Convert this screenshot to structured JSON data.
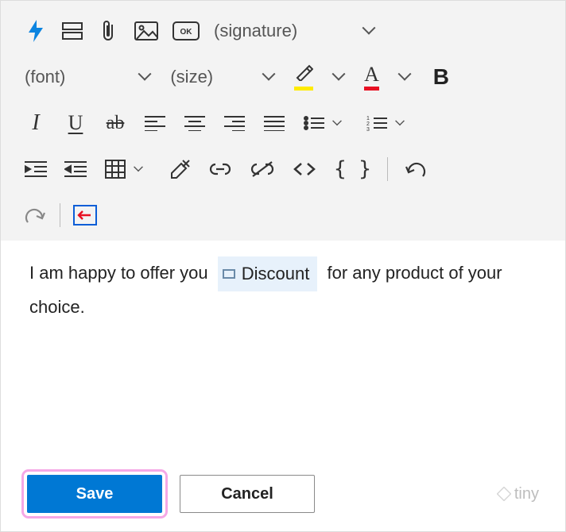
{
  "toolbar": {
    "signature_label": "(signature)",
    "font_label": "(font)",
    "size_label": "(size)",
    "ok_badge": "OK"
  },
  "glyphs": {
    "A": "A",
    "B": "B",
    "I": "I",
    "U": "U",
    "ab": "ab"
  },
  "content": {
    "before": "I am happy to offer you",
    "chip": "Discount",
    "after": "for any product of your choice."
  },
  "footer": {
    "save": "Save",
    "cancel": "Cancel",
    "tiny": "tiny"
  },
  "colors": {
    "accent": "#0078d4",
    "highlight": "#ffeb00",
    "fontcolor": "#e81123"
  }
}
